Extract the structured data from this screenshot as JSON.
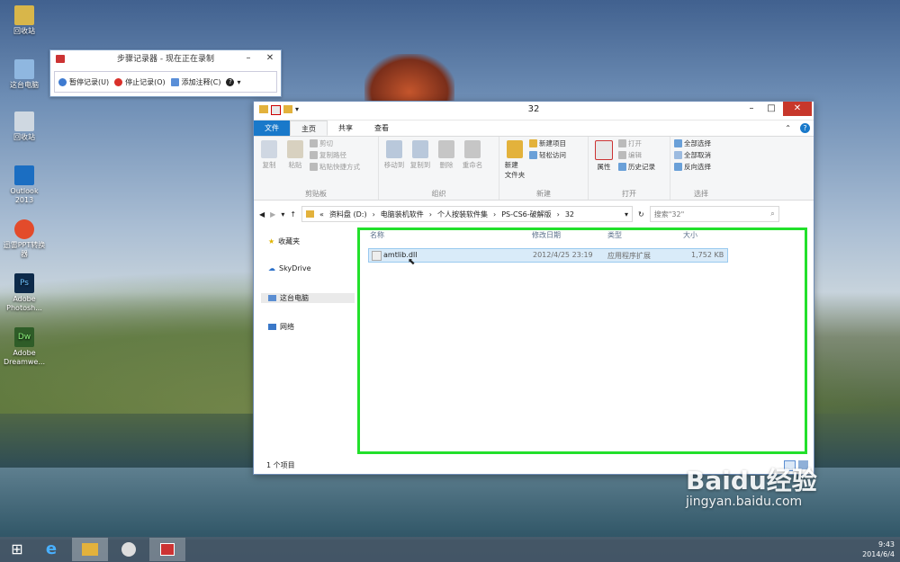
{
  "desktop": {
    "icons": [
      {
        "label": "回收站"
      },
      {
        "label": "这台电脑"
      },
      {
        "label": "回收站"
      },
      {
        "label": "Outlook 2013"
      },
      {
        "label": "迅雷PPT转换器"
      },
      {
        "label": "Adobe Photosh..."
      },
      {
        "label": "Adobe Dreamwe..."
      }
    ]
  },
  "steps_recorder": {
    "title": "步骤记录器 - 现在正在录制",
    "pause": "暂停记录(U)",
    "stop": "停止记录(O)",
    "comment": "添加注释(C)",
    "help": "?"
  },
  "explorer": {
    "title": "32",
    "tabs": [
      "文件",
      "主页",
      "共享",
      "查看"
    ],
    "ribbon": {
      "clipboard": {
        "name": "剪贴板",
        "copy": "复制",
        "paste": "粘贴",
        "cut": "剪切",
        "copy_path": "复制路径",
        "paste_shortcut": "粘贴快捷方式"
      },
      "organize": {
        "name": "组织",
        "move_to": "移动到",
        "copy_to": "复制到",
        "delete": "删除",
        "rename": "重命名"
      },
      "new": {
        "name": "新建",
        "new_folder": "新建\n文件夹",
        "new_item": "新建项目",
        "easy_access": "轻松访问"
      },
      "open": {
        "name": "打开",
        "properties": "属性",
        "open": "打开",
        "edit": "编辑",
        "history": "历史记录"
      },
      "select": {
        "name": "选择",
        "select_all": "全部选择",
        "select_none": "全部取消",
        "invert": "反向选择"
      }
    },
    "address": {
      "crumbs": [
        "«",
        "资料盘 (D:)",
        "电脑装机软件",
        "个人按装软件集",
        "PS-CS6-破解版",
        "32"
      ],
      "search_placeholder": "搜索\"32\""
    },
    "nav": {
      "favorites": "收藏夹",
      "skydrive": "SkyDrive",
      "this_pc": "这台电脑",
      "network": "网络"
    },
    "columns": {
      "name": "名称",
      "date": "修改日期",
      "type": "类型",
      "size": "大小"
    },
    "files": [
      {
        "name": "amtlib.dll",
        "date": "2012/4/25 23:19",
        "type": "应用程序扩展",
        "size": "1,752 KB"
      }
    ],
    "status": "1 个项目"
  },
  "taskbar": {
    "time": "9:43",
    "date": "2014/6/4"
  },
  "watermark": {
    "brand": "Baidu经验",
    "url": "jingyan.baidu.com"
  },
  "colors": {
    "accent": "#1979ca",
    "highlight_border": "#22e02b",
    "selection": "#d9ebf9",
    "close": "#c7372b"
  }
}
